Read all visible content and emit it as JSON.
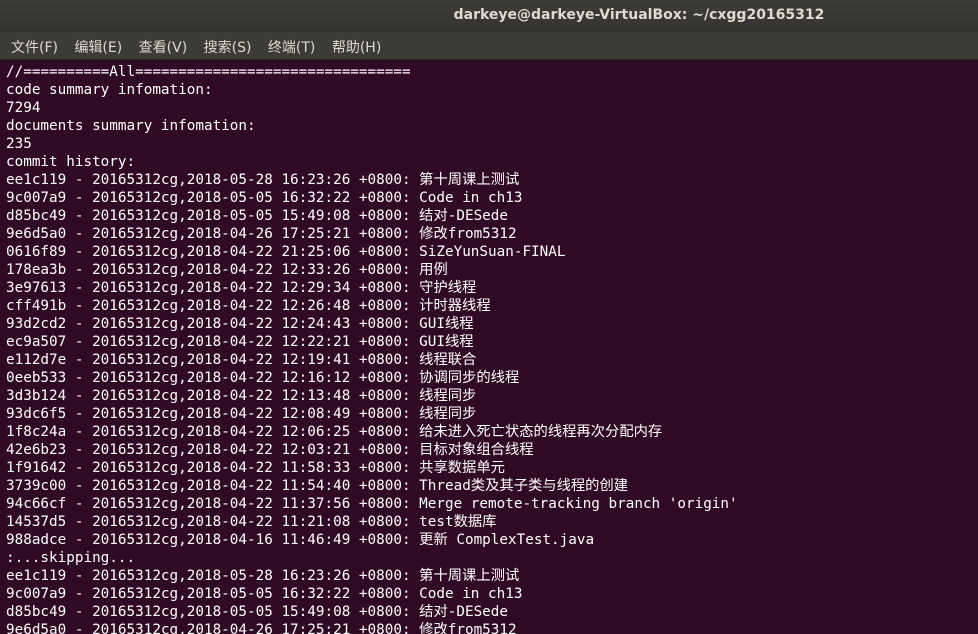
{
  "window": {
    "title": "darkeye@darkeye-VirtualBox: ~/cxgg20165312"
  },
  "menu": [
    {
      "label": "文件(F)"
    },
    {
      "label": "编辑(E)"
    },
    {
      "label": "查看(V)"
    },
    {
      "label": "搜索(S)"
    },
    {
      "label": "终端(T)"
    },
    {
      "label": "帮助(H)"
    }
  ],
  "terminal": {
    "lines": [
      "//==========All================================",
      "code summary infomation:",
      "7294",
      "documents summary infomation:",
      "235",
      "commit history:",
      "ee1c119 - 20165312cg,2018-05-28 16:23:26 +0800: 第十周课上测试",
      "9c007a9 - 20165312cg,2018-05-05 16:32:22 +0800: Code in ch13",
      "d85bc49 - 20165312cg,2018-05-05 15:49:08 +0800: 结对-DESede",
      "9e6d5a0 - 20165312cg,2018-04-26 17:25:21 +0800: 修改from5312",
      "0616f89 - 20165312cg,2018-04-22 21:25:06 +0800: SiZeYunSuan-FINAL",
      "178ea3b - 20165312cg,2018-04-22 12:33:26 +0800: 用例",
      "3e97613 - 20165312cg,2018-04-22 12:29:34 +0800: 守护线程",
      "cff491b - 20165312cg,2018-04-22 12:26:48 +0800: 计时器线程",
      "93d2cd2 - 20165312cg,2018-04-22 12:24:43 +0800: GUI线程",
      "ec9a507 - 20165312cg,2018-04-22 12:22:21 +0800: GUI线程",
      "e112d7e - 20165312cg,2018-04-22 12:19:41 +0800: 线程联合",
      "0eeb533 - 20165312cg,2018-04-22 12:16:12 +0800: 协调同步的线程",
      "3d3b124 - 20165312cg,2018-04-22 12:13:48 +0800: 线程同步",
      "93dc6f5 - 20165312cg,2018-04-22 12:08:49 +0800: 线程同步",
      "1f8c24a - 20165312cg,2018-04-22 12:06:25 +0800: 给未进入死亡状态的线程再次分配内存",
      "42e6b23 - 20165312cg,2018-04-22 12:03:21 +0800: 目标对象组合线程",
      "1f91642 - 20165312cg,2018-04-22 11:58:33 +0800: 共享数据单元",
      "3739c00 - 20165312cg,2018-04-22 11:54:40 +0800: Thread类及其子类与线程的创建",
      "94c66cf - 20165312cg,2018-04-22 11:37:56 +0800: Merge remote-tracking branch 'origin'",
      "14537d5 - 20165312cg,2018-04-22 11:21:08 +0800: test数据库",
      "988adce - 20165312cg,2018-04-16 11:46:49 +0800: 更新 ComplexTest.java",
      ":...skipping...",
      "ee1c119 - 20165312cg,2018-05-28 16:23:26 +0800: 第十周课上测试",
      "9c007a9 - 20165312cg,2018-05-05 16:32:22 +0800: Code in ch13",
      "d85bc49 - 20165312cg,2018-05-05 15:49:08 +0800: 结对-DESede",
      "9e6d5a0 - 20165312cg,2018-04-26 17:25:21 +0800: 修改from5312"
    ]
  },
  "colors": {
    "terminal_bg": "#300a24",
    "terminal_fg": "#ffffff",
    "titlebar_bg": "#3c3b37"
  }
}
